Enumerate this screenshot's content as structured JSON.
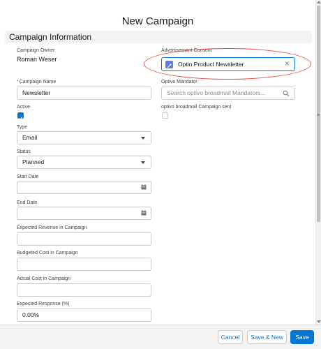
{
  "modal": {
    "title": "New Campaign"
  },
  "section": {
    "title": "Campaign Information"
  },
  "left": {
    "owner_label": "Campaign Owner",
    "owner_value": "Roman Weser",
    "name_required": "*",
    "name_label": "Campaign Name",
    "name_value": "Newsletter",
    "active_label": "Active",
    "active_checked": true,
    "type_label": "Type",
    "type_value": "Email",
    "status_label": "Status",
    "status_value": "Planned",
    "start_date_label": "Start Date",
    "start_date_value": "",
    "end_date_label": "End Date",
    "end_date_value": "",
    "expected_revenue_label": "Expected Revenue in Campaign",
    "expected_revenue_value": "",
    "budgeted_cost_label": "Budgeted Cost in Campaign",
    "budgeted_cost_value": "",
    "actual_cost_label": "Actual Cost in Campaign",
    "actual_cost_value": "",
    "expected_response_label": "Expected Response (%)",
    "expected_response_value": "0.00%"
  },
  "right": {
    "consent_label": "Advertisement Consent",
    "consent_pill": "Optin Product Newsletter",
    "mandator_label": "Optivo Mandator",
    "mandator_placeholder": "Search optivo broadmail Mandators...",
    "campaign_sent_label": "optivo broadmail Campaign sent",
    "campaign_sent_checked": false
  },
  "footer": {
    "cancel": "Cancel",
    "save_new": "Save & New",
    "save": "Save"
  },
  "colors": {
    "brand": "#0176d3",
    "annotation": "#e74c3c",
    "pill_icon": "#5b7cf0"
  },
  "icons": {
    "calendar": "calendar-icon",
    "search": "search-icon",
    "close": "close-icon",
    "check": "check-icon"
  }
}
